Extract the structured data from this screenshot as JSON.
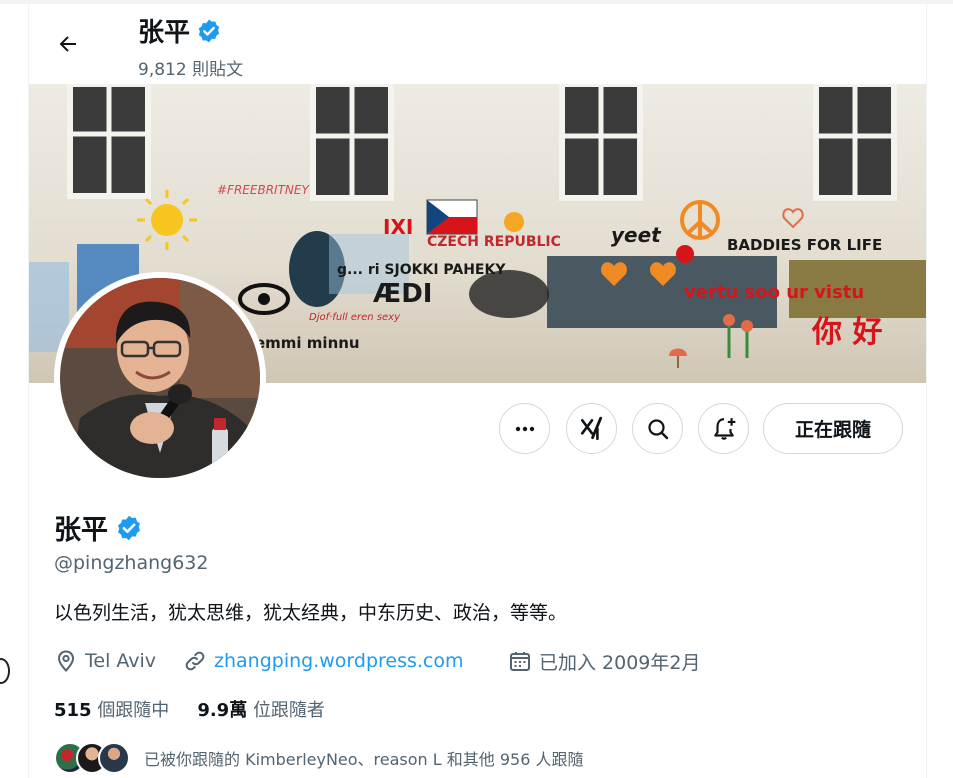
{
  "header": {
    "name": "张平",
    "post_count": "9,812 則貼文"
  },
  "banner": {
    "graffiti": {
      "free_britney": "#FREEBRITNEY",
      "czech_republic": "CZECH REPUBLIC",
      "yeet": "yeet",
      "baddies": "BADDIES FOR LIFE",
      "greetings": "g... ri SJOKKI PAHEKY",
      "aedi": "ÆDI",
      "djof": "Djof·full eren sexy",
      "emmi": "emmi minnu",
      "ixi": "IXI",
      "vertu": "vertu soo ur vistu",
      "nihao": "你 好"
    }
  },
  "actions": {
    "more_label": "•••",
    "follow_label": "正在跟隨"
  },
  "profile": {
    "name": "张平",
    "handle": "@pingzhang632",
    "bio": "以色列生活，犹太思维，犹太经典，中东历史、政治，等等。",
    "location": "Tel Aviv",
    "website": "zhangping.wordpress.com",
    "joined": "已加入 2009年2月"
  },
  "stats": {
    "following_count": "515",
    "following_label": "個跟隨中",
    "followers_count": "9.9萬",
    "followers_label": "位跟隨者"
  },
  "followed_by": {
    "text": "已被你跟隨的 KimberleyNeo、reason L 和其他 956 人跟隨"
  },
  "colors": {
    "accent": "#1d9bf0",
    "verified": "#1d9bf0",
    "secondary_text": "#536471",
    "border": "#cfd9de"
  }
}
